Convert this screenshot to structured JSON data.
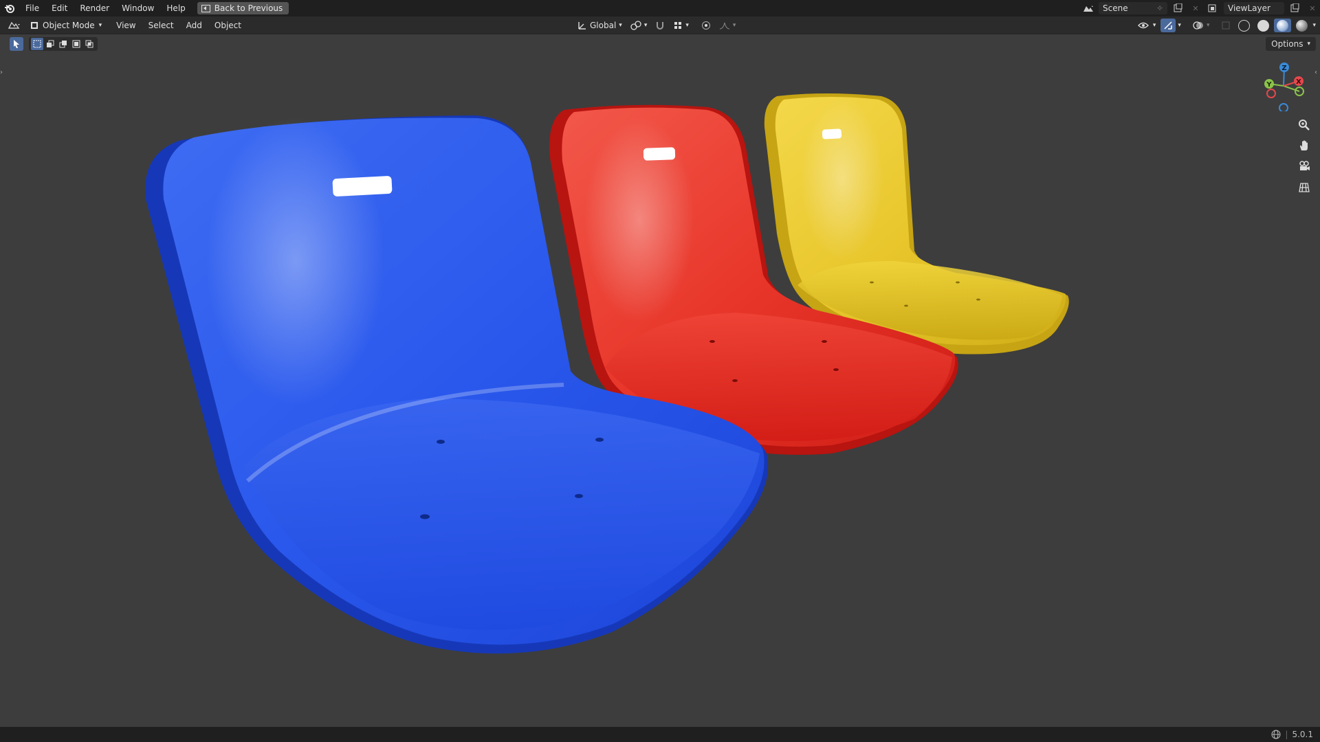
{
  "menu": {
    "file": "File",
    "edit": "Edit",
    "render": "Render",
    "window": "Window",
    "help": "Help",
    "back_to_previous": "Back to Previous"
  },
  "topbar_right": {
    "scene": "Scene",
    "view_layer": "ViewLayer"
  },
  "header": {
    "mode": "Object Mode",
    "view": "View",
    "select": "Select",
    "add": "Add",
    "object": "Object",
    "transform_orientation": "Global",
    "options": "Options"
  },
  "gizmo": {
    "z": "Z",
    "y": "Y",
    "x": "X",
    "colors": {
      "x": "#e5484d",
      "y": "#8bc34a",
      "z": "#3a8ad8"
    }
  },
  "nav_icons": [
    "zoom-icon",
    "hand-pan-icon",
    "camera-icon",
    "ortho-grid-icon"
  ],
  "scene_objects": [
    {
      "name": "blue-stadium-seat",
      "color": "#2251e8"
    },
    {
      "name": "red-stadium-seat",
      "color": "#e5261e"
    },
    {
      "name": "yellow-stadium-seat",
      "color": "#e6c62a"
    }
  ],
  "status": {
    "version": "5.0.1"
  }
}
